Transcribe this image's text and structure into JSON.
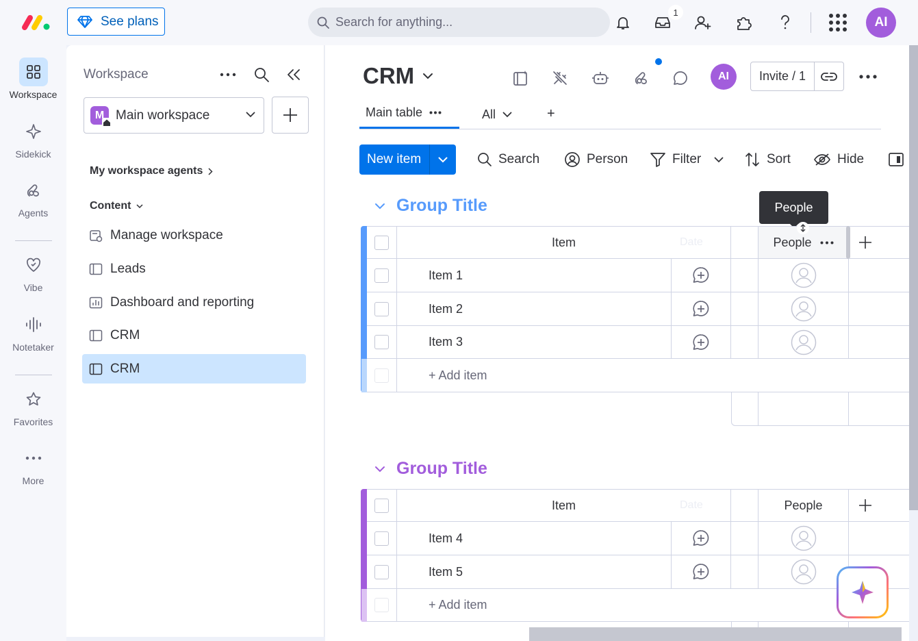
{
  "topbar": {
    "see_plans": "See plans",
    "search_placeholder": "Search for anything...",
    "inbox_count": "1",
    "avatar": "AI"
  },
  "rail": {
    "items": [
      {
        "label": "Workspace"
      },
      {
        "label": "Sidekick"
      },
      {
        "label": "Agents"
      },
      {
        "label": "Vibe"
      },
      {
        "label": "Notetaker"
      },
      {
        "label": "Favorites"
      },
      {
        "label": "More"
      }
    ]
  },
  "workspace": {
    "title": "Workspace",
    "selected": "Main workspace",
    "badge": "M",
    "agents_link": "My workspace agents",
    "content_label": "Content",
    "nav": [
      {
        "label": "Manage workspace"
      },
      {
        "label": "Leads"
      },
      {
        "label": "Dashboard and reporting"
      },
      {
        "label": "CRM"
      },
      {
        "label": "CRM"
      }
    ]
  },
  "board": {
    "title": "CRM",
    "avatar": "AI",
    "invite": "Invite / 1",
    "tabs": {
      "main": "Main table",
      "all": "All",
      "add": "+"
    },
    "toolbar": {
      "new_item": "New item",
      "search": "Search",
      "person": "Person",
      "filter": "Filter",
      "sort": "Sort",
      "hide": "Hide"
    },
    "tooltip": "People",
    "columns": {
      "item": "Item",
      "date": "Date",
      "people": "People"
    },
    "groups": [
      {
        "title": "Group Title",
        "color": "#579bfc",
        "items": [
          "Item 1",
          "Item 2",
          "Item 3"
        ],
        "add_item": "+ Add item"
      },
      {
        "title": "Group Title",
        "color": "#a25ddc",
        "items": [
          "Item 4",
          "Item 5"
        ],
        "add_item": "+ Add item"
      }
    ]
  }
}
